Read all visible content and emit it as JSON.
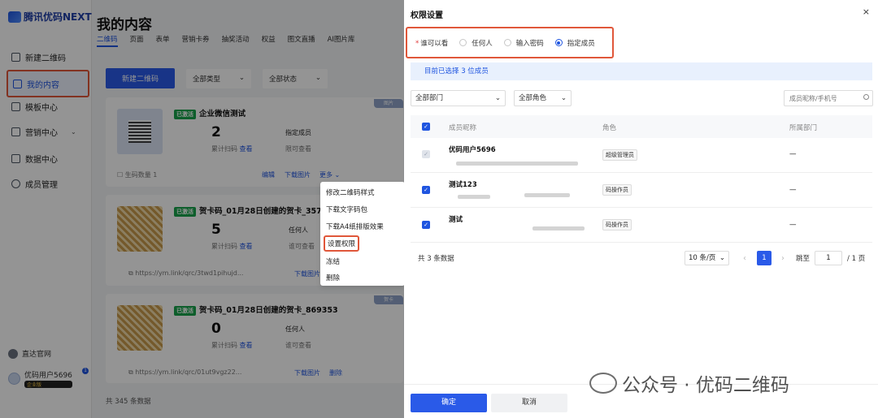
{
  "app": {
    "logo": "腾讯优码NEXT"
  },
  "sidebar": {
    "items": [
      {
        "label": "新建二维码",
        "icon": "grid-icon"
      },
      {
        "label": "我的内容",
        "icon": "document-icon",
        "active": true
      },
      {
        "label": "模板中心",
        "icon": "template-icon"
      },
      {
        "label": "营销中心",
        "icon": "chart-icon",
        "has_submenu": true
      },
      {
        "label": "数据中心",
        "icon": "data-icon"
      },
      {
        "label": "成员管理",
        "icon": "user-icon"
      }
    ],
    "official_site": "直达官网",
    "user_name": "优码用户5696",
    "vip_label": "企业版",
    "message_count": "1"
  },
  "main": {
    "title": "我的内容",
    "tabs": [
      "二维码",
      "页面",
      "表单",
      "营销卡券",
      "抽奖活动",
      "权益",
      "图文直播",
      "AI图片库"
    ],
    "new_button": "新建二维码",
    "filter_type": "全部类型",
    "filter_status": "全部状态",
    "cards": [
      {
        "status": "已激活",
        "title": "企业微信测试",
        "scan_count": "2",
        "scan_label": "累计扫码",
        "view_link": "查看",
        "permission": "指定成员",
        "permission_label": "限可查看",
        "tag": "图片",
        "generate_label": "生码数量 1",
        "edit": "编辑",
        "download": "下载图片",
        "more": "更多"
      },
      {
        "status": "已激活",
        "title": "贺卡码_01月28日创建的贺卡_35765",
        "scan_count": "5",
        "scan_label": "累计扫码",
        "view_link": "查看",
        "permission": "任何人",
        "permission_label": "谁可查看",
        "url": "https://ym.link/qrc/3twd1pihujd...",
        "download": "下载图片"
      },
      {
        "status": "已激活",
        "title": "贺卡码_01月28日创建的贺卡_869353",
        "scan_count": "0",
        "scan_label": "累计扫码",
        "view_link": "查看",
        "permission": "任何人",
        "permission_label": "谁可查看",
        "url": "https://ym.link/qrc/01ut9vgz22...",
        "download": "下载图片",
        "delete": "删除",
        "tag": "贺卡"
      }
    ],
    "dropdown": [
      "修改二维码样式",
      "下载文字码包",
      "下载A4纸排版效果",
      "设置权限",
      "冻结",
      "删除"
    ],
    "total": "共 345 条数据"
  },
  "drawer": {
    "title": "权限设置",
    "close": "×",
    "who_label": "谁可以看",
    "options": [
      "任何人",
      "输入密码",
      "指定成员"
    ],
    "selected_option": "指定成员",
    "selected_info": "目前已选择 3 位成员",
    "dept_filter": "全部部门",
    "role_filter": "全部角色",
    "search_placeholder": "成员昵称/手机号",
    "columns": [
      "成员昵称",
      "角色",
      "所属部门"
    ],
    "rows": [
      {
        "name": "优码用户5696",
        "role": "超级管理员",
        "dept": "—",
        "disabled": true
      },
      {
        "name": "测试123",
        "role": "码操作员",
        "dept": "—",
        "disabled": false
      },
      {
        "name": "测试",
        "role": "码操作员",
        "dept": "—",
        "disabled": false
      }
    ],
    "total": "共 3 条数据",
    "page_size": "10 条/页",
    "current_page": "1",
    "jump_label": "跳至",
    "jump_value": "1",
    "total_pages": "/ 1 页",
    "ok": "确定",
    "cancel": "取消"
  },
  "watermark": "公众号 · 优码二维码"
}
